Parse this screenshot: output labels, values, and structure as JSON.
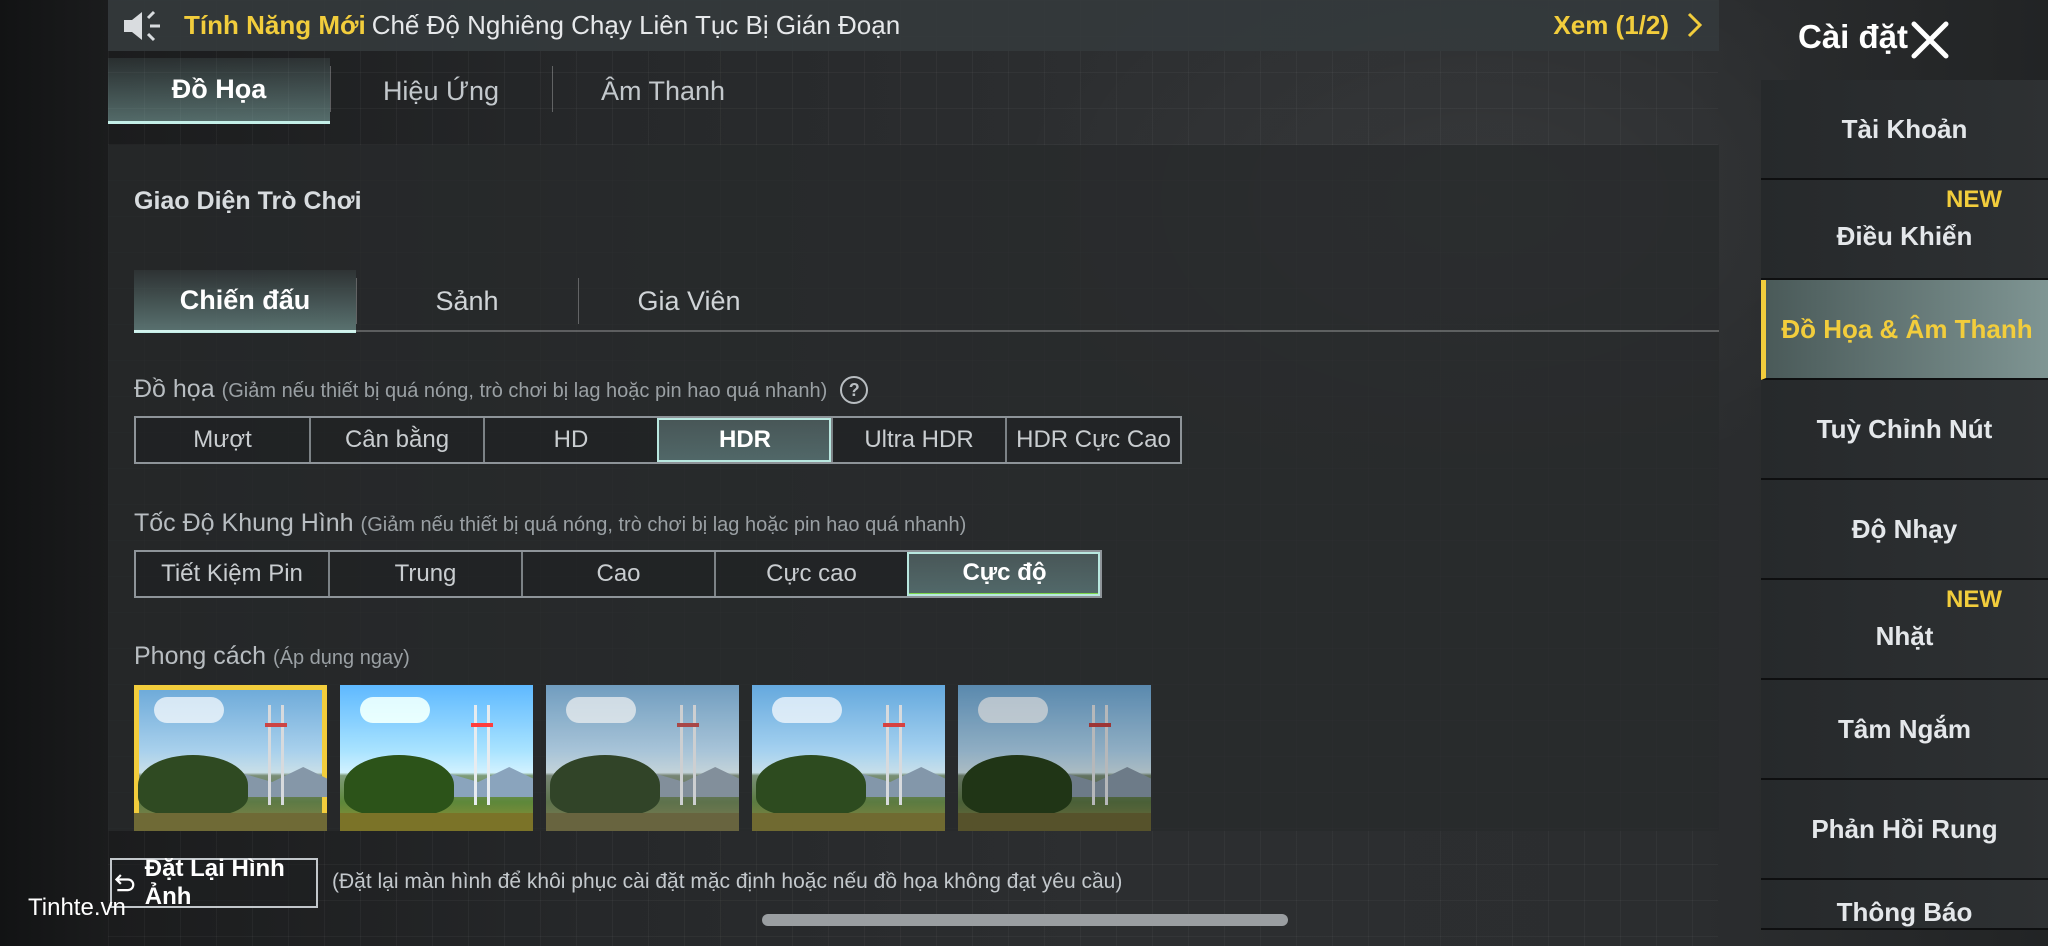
{
  "banner": {
    "highlight": "Tính Năng Mới",
    "message": "Chế Độ Nghiêng Chạy Liên Tục Bị Gián Đoạn",
    "view_label": "Xem (1/2)"
  },
  "main_tabs": [
    {
      "label": "Đồ Họa",
      "active": true
    },
    {
      "label": "Hiệu Ứng",
      "active": false
    },
    {
      "label": "Âm Thanh",
      "active": false
    }
  ],
  "interface_section": {
    "title": "Giao Diện Trò Chơi",
    "tabs": [
      {
        "label": "Chiến đấu",
        "active": true
      },
      {
        "label": "Sảnh",
        "active": false
      },
      {
        "label": "Gia Viên",
        "active": false
      }
    ]
  },
  "graphics": {
    "label": "Đồ họa",
    "note": "(Giảm nếu thiết bị quá nóng, trò chơi bị lag hoặc pin hao quá nhanh)",
    "help": "?",
    "options": [
      "Mượt",
      "Cân bằng",
      "HD",
      "HDR",
      "Ultra HDR",
      "HDR Cực Cao"
    ],
    "selected": "HDR"
  },
  "frame_rate": {
    "label": "Tốc Độ Khung Hình",
    "note": "(Giảm nếu thiết bị quá nóng, trò chơi bị lag hoặc pin hao quá nhanh)",
    "options": [
      "Tiết Kiệm Pin",
      "Trung",
      "Cao",
      "Cực cao",
      "Cực độ"
    ],
    "selected": "Cực độ"
  },
  "style": {
    "label": "Phong cách",
    "note": "(Áp dụng ngay)",
    "thumbnail_count": 5,
    "selected_index": 0
  },
  "reset": {
    "button_label": "Đặt Lại Hình Ảnh",
    "note": "(Đặt lại màn hình để khôi phục cài đặt mặc định hoặc nếu đồ họa không đạt yêu cầu)"
  },
  "settings": {
    "title": "Cài đặt",
    "items": [
      {
        "label": "Tài Khoản",
        "badge": ""
      },
      {
        "label": "Điều Khiển",
        "badge": "NEW"
      },
      {
        "label": "Đồ Họa & Âm Thanh",
        "badge": "",
        "active": true
      },
      {
        "label": "Tuỳ Chỉnh Nút",
        "badge": ""
      },
      {
        "label": "Độ Nhạy",
        "badge": ""
      },
      {
        "label": "Nhặt",
        "badge": "NEW"
      },
      {
        "label": "Tâm Ngắm",
        "badge": ""
      },
      {
        "label": "Phản Hồi Rung",
        "badge": ""
      },
      {
        "label": "Thông Báo",
        "badge": ""
      }
    ]
  },
  "watermark": "Tinhte.vn",
  "colors": {
    "accent_yellow": "#f2cd3c",
    "active_teal": "#c4efe8",
    "selected_green": "#7cd64a"
  },
  "icons": {
    "banner": "speaker-icon",
    "view_more": "chevron-right-icon",
    "close": "close-icon",
    "reset": "undo-arrow-icon",
    "help": "question-circle-icon"
  }
}
